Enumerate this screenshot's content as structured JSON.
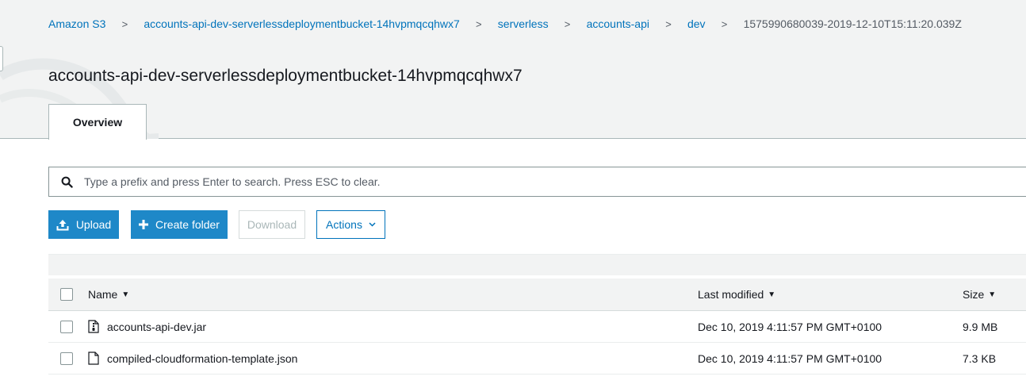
{
  "breadcrumb": {
    "items": [
      {
        "label": "Amazon S3"
      },
      {
        "label": "accounts-api-dev-serverlessdeploymentbucket-14hvpmqcqhwx7"
      },
      {
        "label": "serverless"
      },
      {
        "label": "accounts-api"
      },
      {
        "label": "dev"
      },
      {
        "label": "1575990680039-2019-12-10T15:11:20.039Z"
      }
    ],
    "separator": ">"
  },
  "page": {
    "title": "accounts-api-dev-serverlessdeploymentbucket-14hvpmqcqhwx7"
  },
  "tabs": [
    {
      "label": "Overview",
      "active": true
    }
  ],
  "search": {
    "value": "",
    "placeholder": "Type a prefix and press Enter to search. Press ESC to clear."
  },
  "toolbar": {
    "upload_label": "Upload",
    "create_folder_label": "Create folder",
    "download_label": "Download",
    "actions_label": "Actions"
  },
  "table": {
    "columns": {
      "name": "Name",
      "last_modified": "Last modified",
      "size": "Size"
    },
    "rows": [
      {
        "name": "accounts-api-dev.jar",
        "last_modified": "Dec 10, 2019 4:11:57 PM GMT+0100",
        "size": "9.9 MB",
        "icon": "archive-file-icon"
      },
      {
        "name": "compiled-cloudformation-template.json",
        "last_modified": "Dec 10, 2019 4:11:57 PM GMT+0100",
        "size": "7.3 KB",
        "icon": "file-icon"
      }
    ]
  },
  "colors": {
    "link": "#0073bb",
    "primary_button": "#1e88c8",
    "header_bg": "#f2f3f3"
  }
}
